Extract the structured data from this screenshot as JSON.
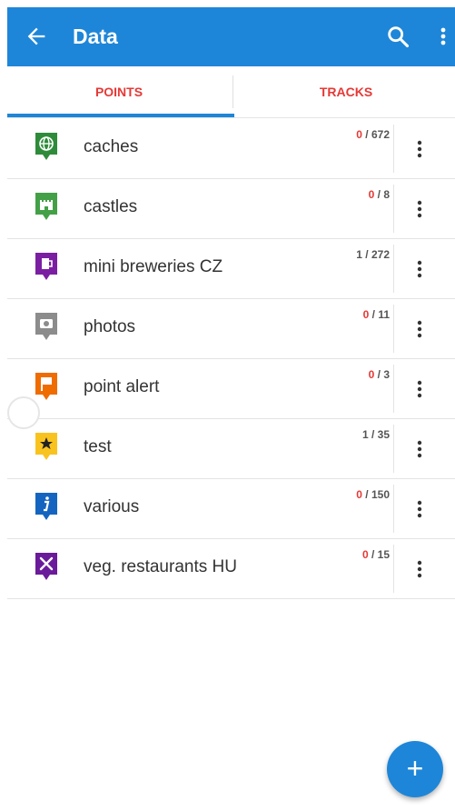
{
  "header": {
    "title": "Data",
    "back_icon": "arrow-left-icon",
    "search_icon": "search-icon",
    "more_icon": "more-vert-icon",
    "color": "#1e86d8"
  },
  "tabs": [
    {
      "label": "POINTS",
      "active": true
    },
    {
      "label": "TRACKS",
      "active": false
    }
  ],
  "folders": [
    {
      "name": "caches",
      "visible": "0",
      "total": "672",
      "icon": "globe-icon",
      "color": "#2e8b3a",
      "visible_red": true
    },
    {
      "name": "castles",
      "visible": "0",
      "total": "8",
      "icon": "castle-icon",
      "color": "#43a047",
      "visible_red": true
    },
    {
      "name": "mini breweries CZ",
      "visible": "1",
      "total": "272",
      "icon": "beer-icon",
      "color": "#7b1fa2",
      "visible_red": false
    },
    {
      "name": "photos",
      "visible": "0",
      "total": "11",
      "icon": "camera-icon",
      "color": "#8c8c8c",
      "visible_red": true
    },
    {
      "name": "point alert",
      "visible": "0",
      "total": "3",
      "icon": "flag-icon",
      "color": "#ef6c00",
      "visible_red": true
    },
    {
      "name": "test",
      "visible": "1",
      "total": "35",
      "icon": "star-icon",
      "color": "#f9c31f",
      "visible_red": false
    },
    {
      "name": "various",
      "visible": "0",
      "total": "150",
      "icon": "info-icon",
      "color": "#1565c0",
      "visible_red": true
    },
    {
      "name": "veg. restaurants HU",
      "visible": "0",
      "total": "15",
      "icon": "restaurant-icon",
      "color": "#6a1b9a",
      "visible_red": true
    }
  ],
  "fab": {
    "label": "+",
    "icon": "add-icon"
  }
}
